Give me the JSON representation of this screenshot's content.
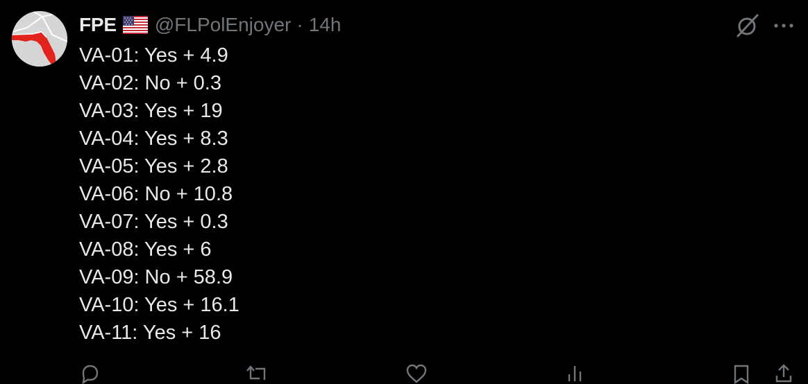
{
  "colors": {
    "background": "#000000",
    "text_primary": "#e7e9ea",
    "text_secondary": "#71767b"
  },
  "author": {
    "display_name": "FPE",
    "flag_icon": "us-flag-icon",
    "handle": "@FLPolEnjoyer",
    "separator": "·",
    "timestamp": "14h",
    "avatar_icon": "florida-map-avatar"
  },
  "header_icons": {
    "grok": "grok-icon",
    "more": "more-icon"
  },
  "tweet_lines": [
    "VA-01: Yes + 4.9",
    "VA-02: No + 0.3",
    "VA-03: Yes + 19",
    "VA-04: Yes + 8.3",
    "VA-05: Yes + 2.8",
    "VA-06: No + 10.8",
    "VA-07: Yes + 0.3",
    "VA-08: Yes + 6",
    "VA-09: No + 58.9",
    "VA-10: Yes + 16.1",
    "VA-11: Yes + 16"
  ],
  "action_bar": [
    {
      "icon": "reply-icon"
    },
    {
      "icon": "repost-icon"
    },
    {
      "icon": "like-icon"
    },
    {
      "icon": "views-icon"
    },
    {
      "icon": "bookmark-icon"
    },
    {
      "icon": "share-icon"
    }
  ]
}
